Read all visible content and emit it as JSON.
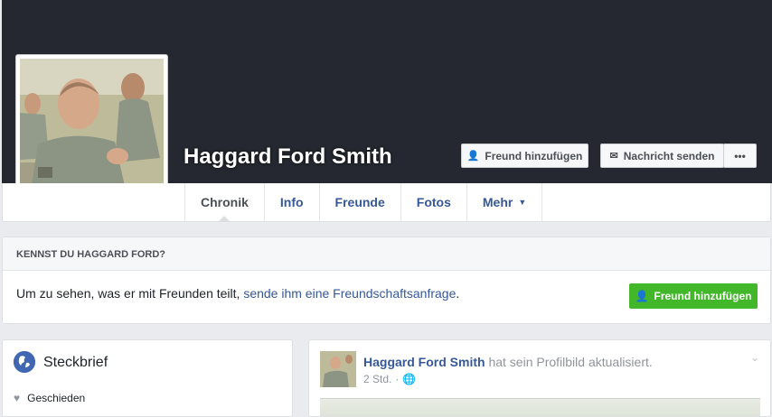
{
  "profile": {
    "name": "Haggard Ford Smith",
    "add_friend_label": "Freund hinzufügen",
    "message_label": "Nachricht senden",
    "more_label": "•••"
  },
  "tabs": [
    {
      "label": "Chronik"
    },
    {
      "label": "Info"
    },
    {
      "label": "Freunde"
    },
    {
      "label": "Fotos"
    },
    {
      "label": "Mehr"
    }
  ],
  "know_box": {
    "heading": "KENNST DU HAGGARD FORD?",
    "text": "Um zu sehen, was er mit Freunden teilt,",
    "link": "sende ihm eine Freundschaftsanfrage",
    "link_suffix": ".",
    "button_label": "Freund hinzufügen"
  },
  "intro": {
    "title": "Steckbrief",
    "relationship": "Geschieden"
  },
  "post": {
    "author": "Haggard Ford Smith",
    "action": "hat sein Profilbild aktualisiert.",
    "time": "2 Std."
  },
  "colors": {
    "cover": "#252830",
    "link": "#365899",
    "green_button": "#42b72a",
    "background": "#e9ebee"
  }
}
